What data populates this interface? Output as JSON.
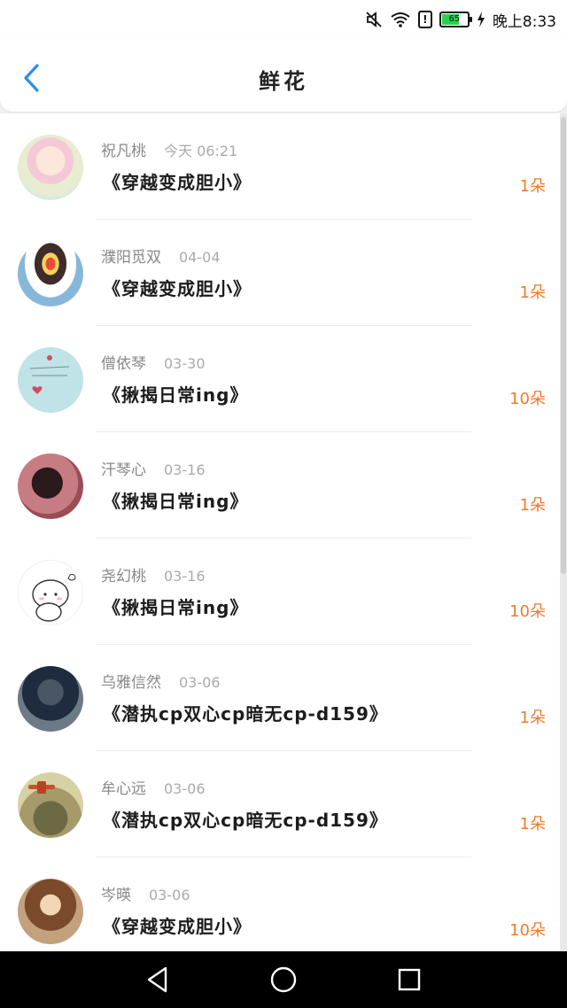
{
  "status_bar": {
    "battery_level": "65",
    "time": "晚上8:33",
    "icons": [
      "mute-icon",
      "wifi-icon",
      "alert-icon",
      "battery-icon",
      "charging-icon"
    ]
  },
  "header": {
    "title": "鲜花",
    "back_icon": "chevron-left-icon",
    "accent_color": "#2a8cf0"
  },
  "items": [
    {
      "name": "祝凡桃",
      "date": "今天 06:21",
      "topic": "《穿越变成胆小》",
      "count": "1朵"
    },
    {
      "name": "濮阳觅双",
      "date": "04-04",
      "topic": "《穿越变成胆小》",
      "count": "1朵"
    },
    {
      "name": "僧依琴",
      "date": "03-30",
      "topic": "《揪揭日常ing》",
      "count": "10朵"
    },
    {
      "name": "汗琴心",
      "date": "03-16",
      "topic": "《揪揭日常ing》",
      "count": "1朵"
    },
    {
      "name": "尧幻桃",
      "date": "03-16",
      "topic": "《揪揭日常ing》",
      "count": "10朵"
    },
    {
      "name": "乌雅信然",
      "date": "03-06",
      "topic": "《潜执cp双心cp暗无cp-d159》",
      "count": "1朵"
    },
    {
      "name": "牟心远",
      "date": "03-06",
      "topic": "《潜执cp双心cp暗无cp-d159》",
      "count": "1朵"
    },
    {
      "name": "岑暎",
      "date": "03-06",
      "topic": "《穿越变成胆小》",
      "count": "10朵"
    }
  ],
  "colors": {
    "count": "#f07a2c",
    "name": "#888888",
    "date": "#aaaaaa"
  },
  "nav_bar": {
    "icons": [
      "back-triangle-icon",
      "home-circle-icon",
      "recents-square-icon"
    ]
  }
}
